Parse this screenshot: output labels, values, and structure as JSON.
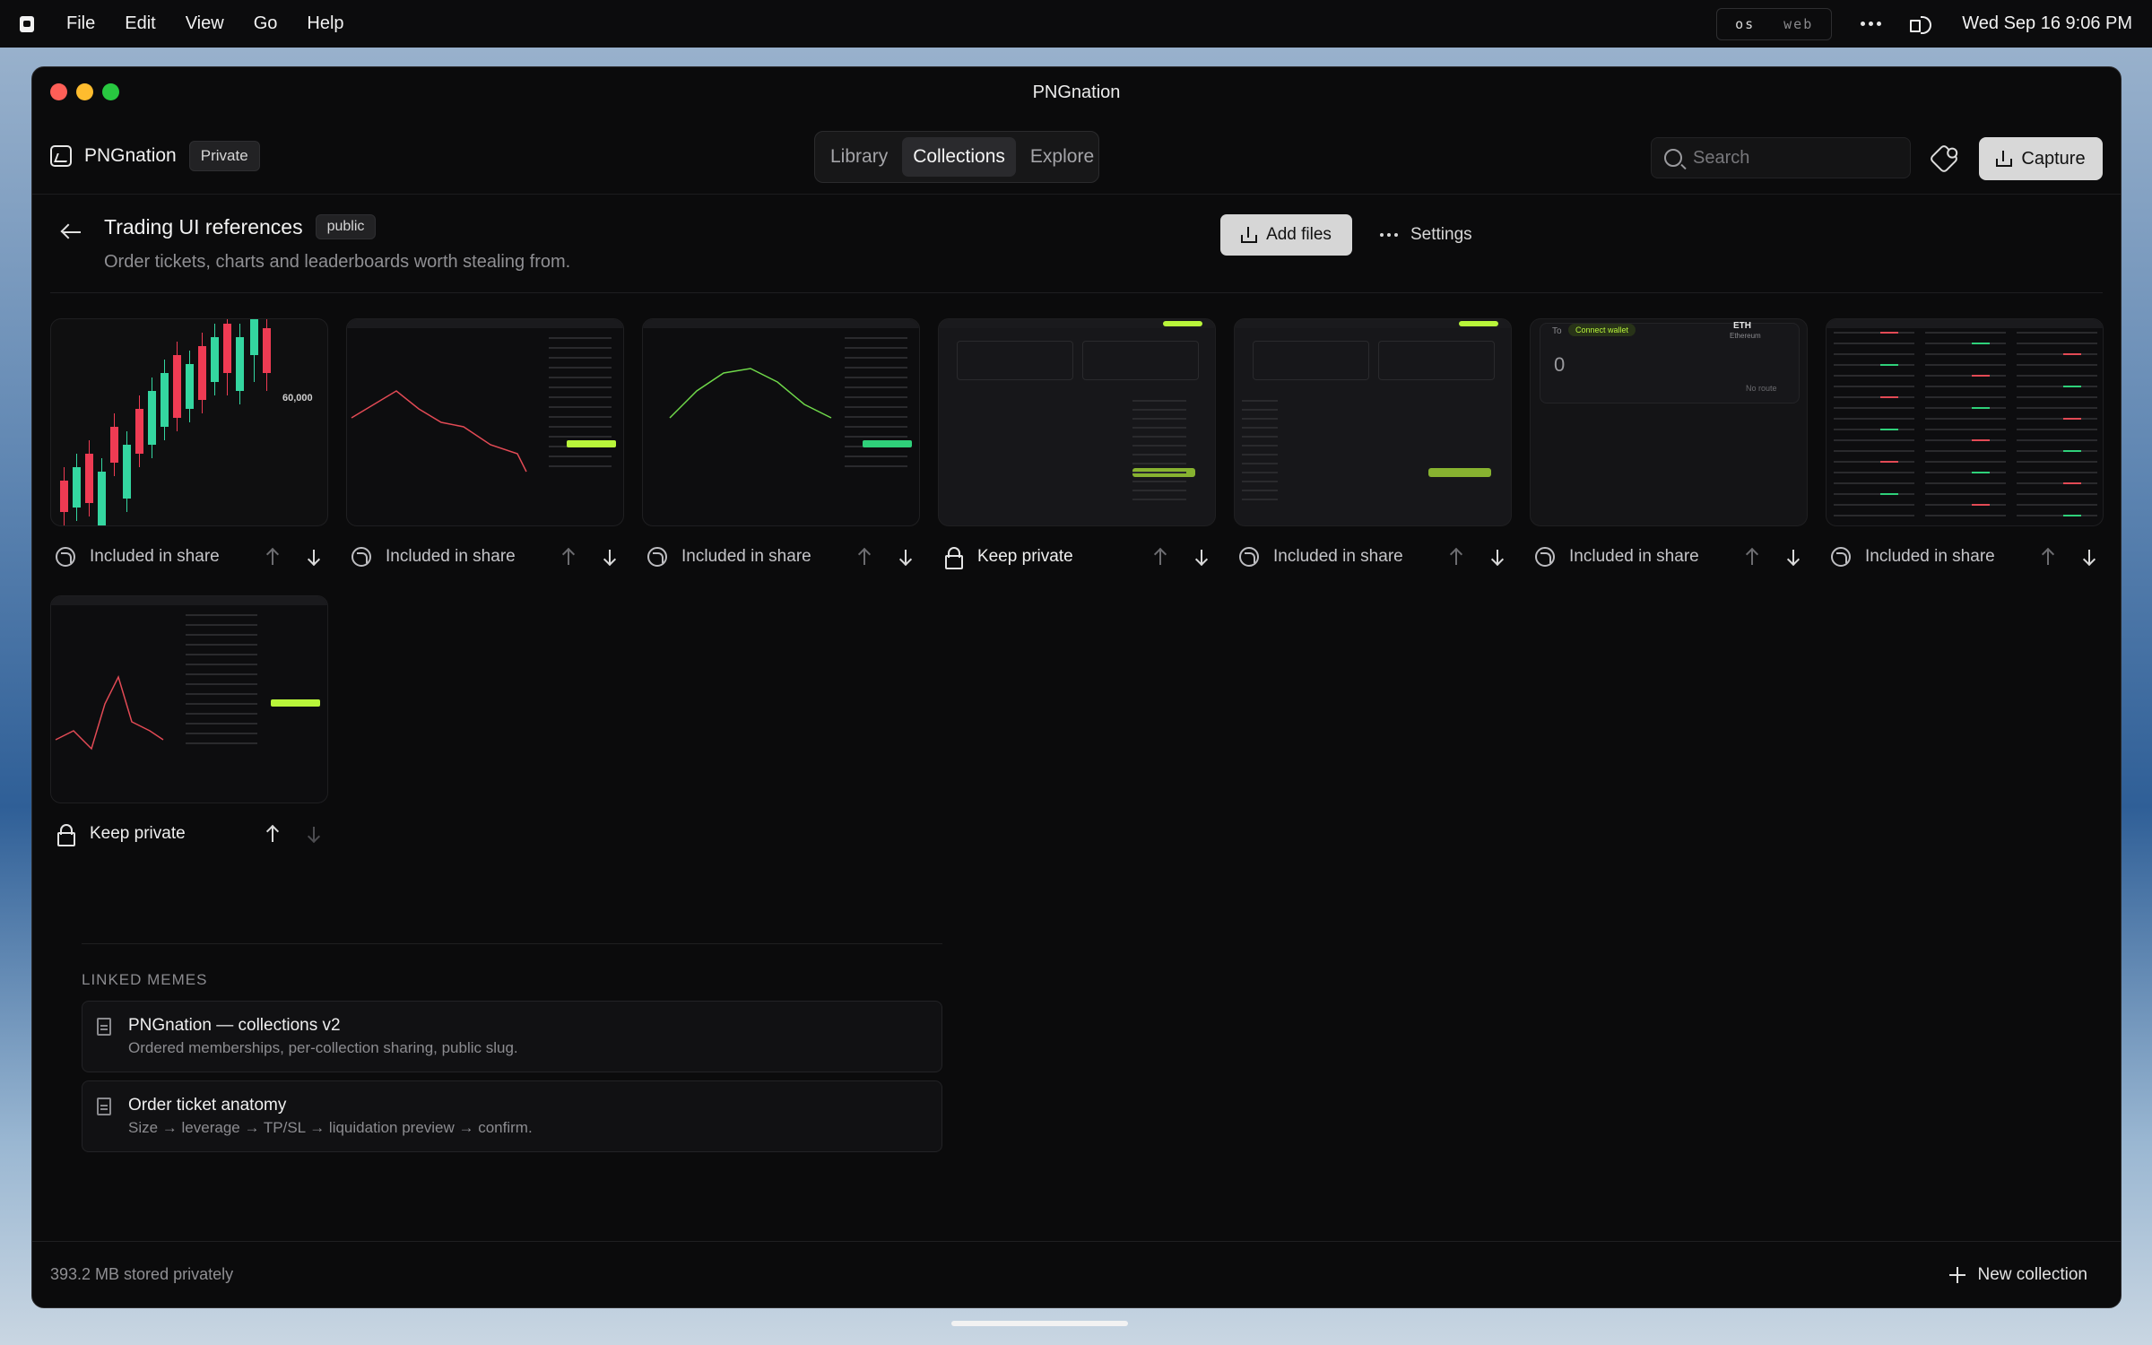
{
  "menubar": {
    "items": [
      "File",
      "Edit",
      "View",
      "Go",
      "Help"
    ],
    "mode_options": [
      "os",
      "web"
    ],
    "datetime": "Wed Sep 16 9:06 PM"
  },
  "window": {
    "title": "PNGnation"
  },
  "toolbar": {
    "brand": "PNGnation",
    "privacy_badge": "Private",
    "tabs": [
      "Library",
      "Collections",
      "Explore"
    ],
    "active_tab": "Collections",
    "search_placeholder": "Search",
    "capture_label": "Capture"
  },
  "collection": {
    "title": "Trading UI references",
    "visibility_badge": "public",
    "description": "Order tickets, charts and leaderboards worth stealing from.",
    "add_files_label": "Add files",
    "settings_label": "Settings"
  },
  "items": [
    {
      "status": "Included in share",
      "private": false,
      "thumb_text": "60,000"
    },
    {
      "status": "Included in share",
      "private": false
    },
    {
      "status": "Included in share",
      "private": false
    },
    {
      "status": "Keep private",
      "private": true
    },
    {
      "status": "Included in share",
      "private": false
    },
    {
      "status": "Included in share",
      "private": false,
      "thumb_token": "ETH",
      "thumb_network": "Ethereum",
      "thumb_wallet": "Connect wallet",
      "thumb_value": "0",
      "thumb_to": "To",
      "thumb_route": "No route"
    },
    {
      "status": "Included in share",
      "private": false
    },
    {
      "status": "Keep private",
      "private": true
    }
  ],
  "linked": {
    "label": "LINKED MEMES",
    "memos": [
      {
        "title": "PNGnation — collections v2",
        "subtitle": "Ordered memberships, per-collection sharing, public slug."
      },
      {
        "title": "Order ticket anatomy",
        "subtitle": "Size → leverage → TP/SL → liquidation preview → confirm."
      }
    ]
  },
  "footer": {
    "storage": "393.2 MB stored privately",
    "new_collection_label": "New collection"
  }
}
